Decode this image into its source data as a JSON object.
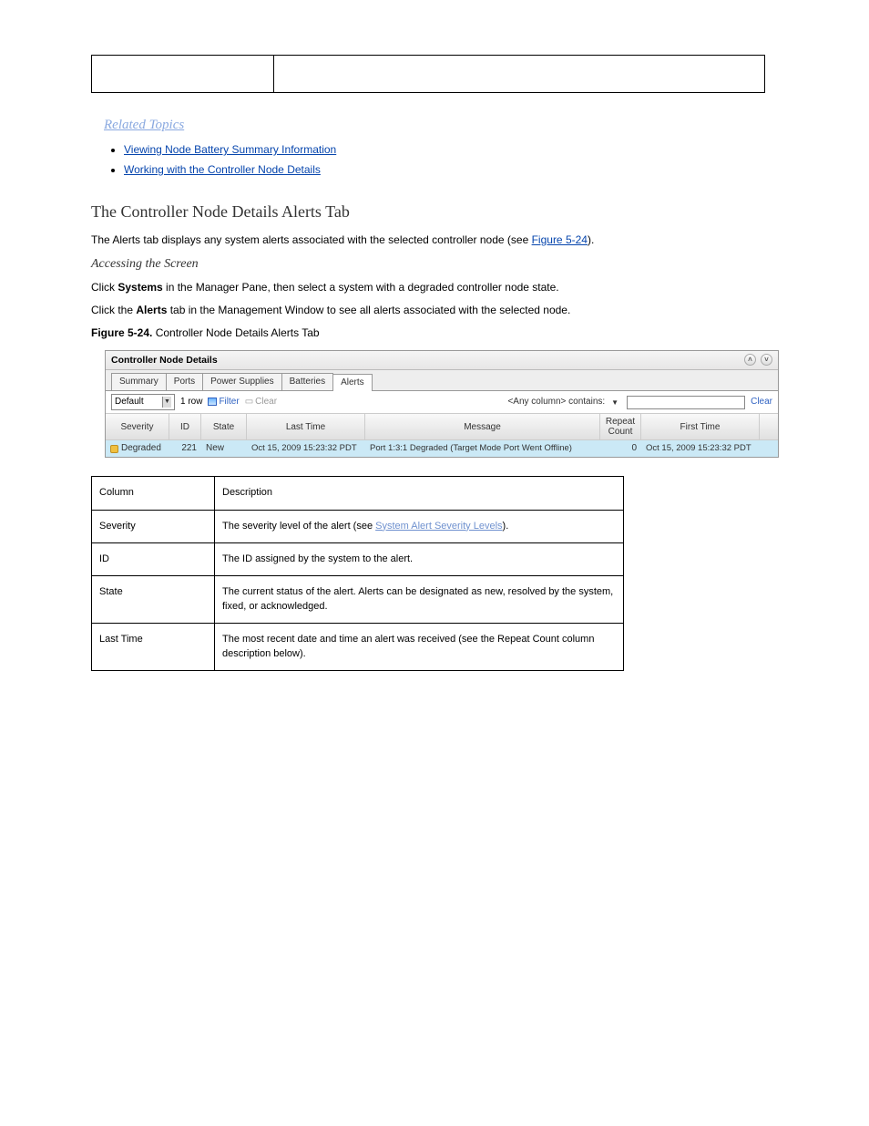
{
  "top_table": {
    "col_left": "",
    "col_right": ""
  },
  "related": {
    "heading": "Related Topics",
    "links": [
      "Viewing Node Battery Summary Information",
      "Working with the Controller Node Details"
    ]
  },
  "alerts_section": {
    "title": "The Controller Node Details Alerts Tab",
    "para": "The Alerts tab displays any system alerts associated with the selected controller node (see",
    "figure_ref": "Figure 5-24",
    "para_cont": ")."
  },
  "access_section": {
    "sub_title": "Accessing the Screen",
    "step1_prefix": "Click ",
    "step1_strong": "Systems",
    "step1_cont": " in the Manager Pane, then select a system with a degraded controller node state.",
    "step2_prefix": "Click the ",
    "step2_strong": "Alerts",
    "step2_cont": " tab in the Management Window to see all alerts associated with the selected node.",
    "figure_caption_prefix": "Figure 5-24.",
    "figure_caption": "Controller Node Details Alerts Tab"
  },
  "panel": {
    "title": "Controller Node Details",
    "tabs": [
      "Summary",
      "Ports",
      "Power Supplies",
      "Batteries",
      "Alerts"
    ],
    "active_tab_index": 4,
    "toolbar": {
      "select_value": "Default",
      "row_count_label": "1 row",
      "filter_label": "Filter",
      "clear_label": "Clear",
      "any_column_label": "<Any column> contains:",
      "clear_link": "Clear"
    },
    "grid": {
      "headers": {
        "severity": "Severity",
        "id": "ID",
        "state": "State",
        "last_time": "Last Time",
        "message": "Message",
        "repeat": "Repeat\nCount",
        "first_time": "First Time"
      },
      "row": {
        "severity": "Degraded",
        "id": "221",
        "state": "New",
        "last_time": "Oct 15, 2009 15:23:32 PDT",
        "message": "Port 1:3:1 Degraded (Target Mode Port Went Offline)",
        "repeat": "0",
        "first_time": "Oct 15, 2009 15:23:32 PDT"
      }
    }
  },
  "def_table": {
    "rows": [
      {
        "term": "Column",
        "def": "Description"
      },
      {
        "term": "Severity",
        "def_pre": "The severity level of the alert (see ",
        "def_link": "System Alert Severity Levels",
        "def_post": ")."
      },
      {
        "term": "ID",
        "def": "The ID assigned by the system to the alert."
      },
      {
        "term": "State",
        "def": "The current status of the alert. Alerts can be designated as new, resolved by the system, fixed, or acknowledged."
      },
      {
        "term": "Last Time",
        "def": "The most recent date and time an alert was received (see the Repeat Count column description below)."
      }
    ]
  }
}
